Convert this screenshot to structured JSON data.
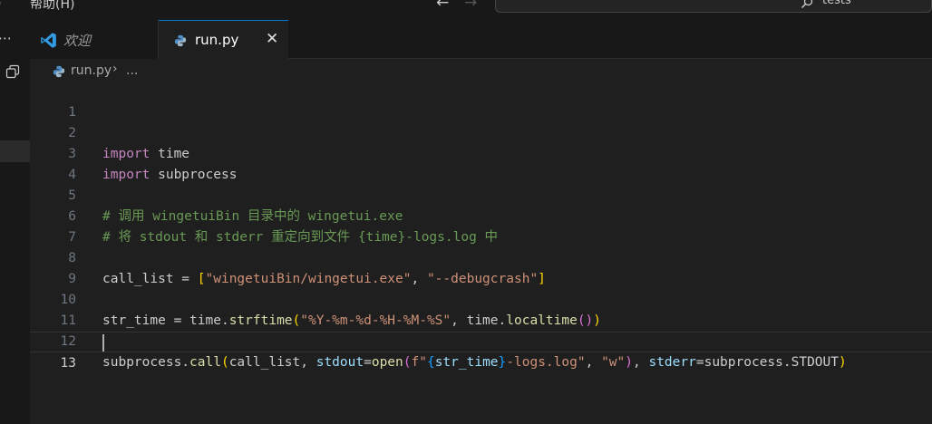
{
  "menu": {
    "partial_left": "）",
    "help": "帮助(H)"
  },
  "nav": {
    "back": "←",
    "forward": "→"
  },
  "search": {
    "text": "tests"
  },
  "activity": {
    "more": "⋯"
  },
  "tabs": [
    {
      "label": "欢迎",
      "active": false
    },
    {
      "label": "run.py",
      "active": true,
      "close": "✕"
    }
  ],
  "breadcrumb": {
    "file": "run.py",
    "sep": "›",
    "more": "..."
  },
  "editor": {
    "current_line": 13,
    "lines": [
      {
        "n": "1"
      },
      {
        "n": "2"
      },
      {
        "n": "3"
      },
      {
        "n": "4"
      },
      {
        "n": "5"
      },
      {
        "n": "6"
      },
      {
        "n": "7"
      },
      {
        "n": "8"
      },
      {
        "n": "9"
      },
      {
        "n": "10"
      },
      {
        "n": "11"
      },
      {
        "n": "12"
      },
      {
        "n": "13"
      }
    ],
    "tokens": {
      "l2_kw": "import",
      "l2_rest": " time",
      "l3_kw": "import",
      "l3_rest": " subprocess",
      "l5_comment": "# 调用 wingetuiBin 目录中的 wingetui.exe",
      "l6_comment": "# 将 stdout 和 stderr 重定向到文件 {time}-logs.log 中",
      "l8_a": "call_list = ",
      "l8_b1": "[",
      "l8_s1": "\"wingetuiBin/wingetui.exe\"",
      "l8_c": ", ",
      "l8_s2": "\"--debugcrash\"",
      "l8_b2": "]",
      "l10_a": "str_time = time.",
      "l10_fn": "strftime",
      "l10_p1": "(",
      "l10_s1": "\"%Y-%m-%d-%H-%M-%S\"",
      "l10_c": ", time.",
      "l10_fn2": "localtime",
      "l10_p2": "()",
      "l10_p3": ")",
      "l12_a": "subprocess.",
      "l12_fn": "call",
      "l12_p1": "(",
      "l12_b": "call_list, ",
      "l12_pm": "stdout",
      "l12_eq": "=",
      "l12_fn2": "open",
      "l12_p2": "(",
      "l12_f": "f\"",
      "l12_br1": "{",
      "l12_var": "str_time",
      "l12_br2": "}",
      "l12_s": "-logs.log\"",
      "l12_c": ", ",
      "l12_s2": "\"w\"",
      "l12_p3": ")",
      "l12_c2": ", ",
      "l12_pm2": "stderr",
      "l12_eq2": "=",
      "l12_rest": "subprocess.STDOUT",
      "l12_p4": ")"
    }
  },
  "colors": {
    "keyword": "#c586c0",
    "comment": "#6a9955",
    "string": "#ce9178",
    "function": "#dcdcaa",
    "parameter": "#9cdcfe",
    "accent": "#0078d4"
  }
}
